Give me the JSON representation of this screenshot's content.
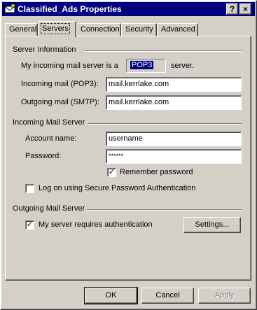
{
  "window": {
    "title": "Classified_Ads Properties",
    "help_glyph": "?",
    "close_glyph": "×"
  },
  "tabs": [
    {
      "label": "General",
      "active": false
    },
    {
      "label": "Servers",
      "active": true
    },
    {
      "label": "Connection",
      "active": false
    },
    {
      "label": "Security",
      "active": false
    },
    {
      "label": "Advanced",
      "active": false
    }
  ],
  "server_info": {
    "heading": "Server Information",
    "incoming_prefix": "My incoming mail server is a",
    "server_type": "POP3",
    "incoming_suffix": "server.",
    "incoming_label": "Incoming mail (POP3):",
    "incoming_value": "mail.kerrlake.com",
    "outgoing_label": "Outgoing mail (SMTP):",
    "outgoing_value": "mail.kerrlake.com"
  },
  "incoming_server": {
    "heading": "Incoming Mail Server",
    "account_label": "Account name:",
    "account_value": "username",
    "password_label": "Password:",
    "password_value": "******",
    "remember_label": "Remember password",
    "remember_checked": true,
    "spa_label": "Log on using Secure Password Authentication",
    "spa_checked": false
  },
  "outgoing_server": {
    "heading": "Outgoing Mail Server",
    "auth_label": "My server requires authentication",
    "auth_checked": true,
    "settings_label": "Settings..."
  },
  "footer": {
    "ok_label": "OK",
    "cancel_label": "Cancel",
    "apply_label": "Apply",
    "apply_enabled": false
  },
  "colors": {
    "titlebar": "#000080",
    "face": "#d4d0c8",
    "selection": "#000080"
  }
}
